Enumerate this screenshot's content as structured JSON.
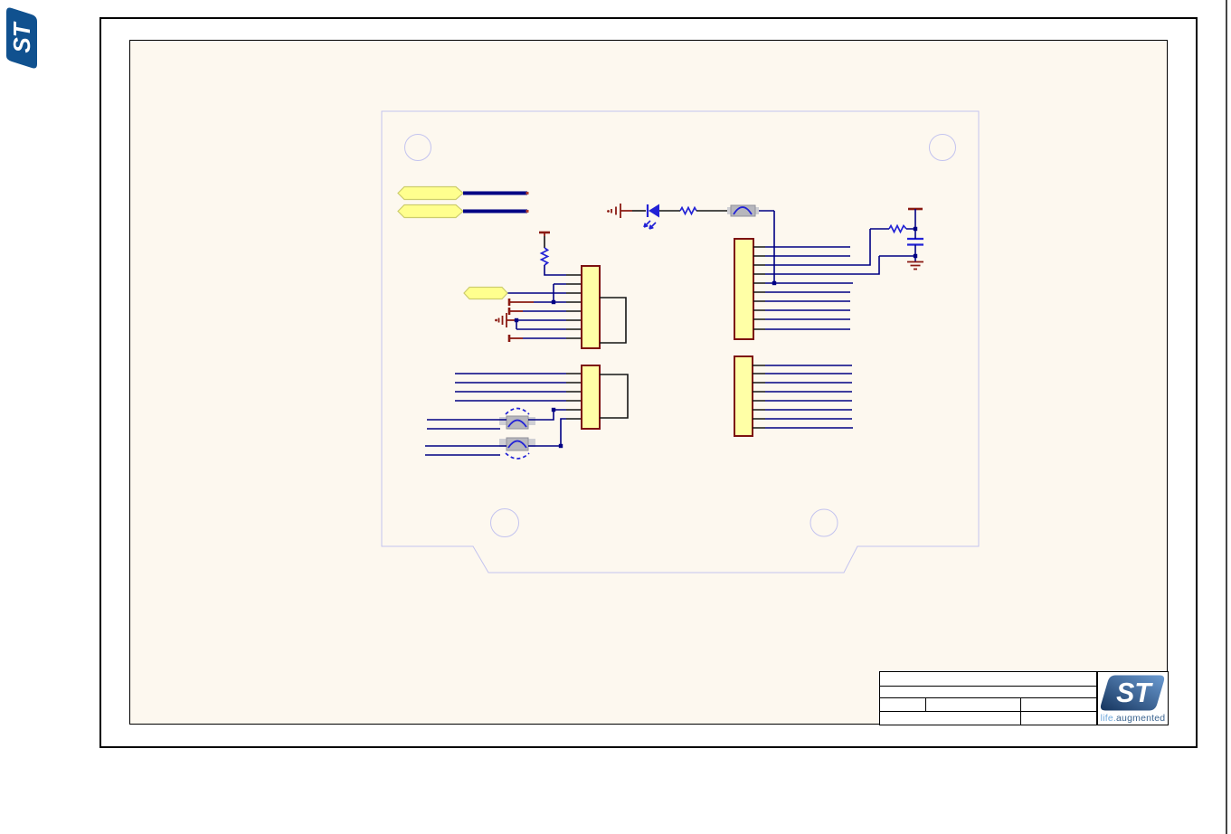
{
  "logos": {
    "st_monogram": "ST",
    "tagline": {
      "prefix": "life.",
      "suffix": "augmented"
    }
  },
  "title_block": {
    "rows": [
      "",
      "",
      "",
      ""
    ],
    "note": ""
  },
  "schematic": {
    "mounting_holes": 4,
    "net_flags": 3,
    "connectors": [
      {
        "id": "upper-left-module",
        "left_pins": 8,
        "right_pins": 2
      },
      {
        "id": "lower-left-module",
        "left_pins": 6,
        "right_pins": 2
      },
      {
        "id": "upper-right-module",
        "right_pins": 10
      },
      {
        "id": "lower-right-module",
        "right_pins": 8
      }
    ],
    "discrete_symbols": [
      "led",
      "series-resistor",
      "ferrite-bead",
      "pull-resistor",
      "filter-resistor",
      "capacitor",
      "solder-bridge",
      "solder-bridge"
    ],
    "ground_symbols": 4,
    "power_bar_symbols": 5
  },
  "colors": {
    "frame": "#000000",
    "sheet_bg": "#fdf8ef",
    "wire": "#000084",
    "pin": "#151515",
    "part_fill": "#ffffa6",
    "part_border": "#7d1111",
    "symbol_blue": "#2222d6",
    "power_red": "#8a1a12",
    "outline": "#c3c3ef",
    "jumper_gray": "#b7b7bd",
    "jumper_pad": "#cfcfd4",
    "flag_fill": "#ffff8e",
    "flag_border": "#cdcd6d",
    "logo_blue": "#10518f",
    "logo_grad_dark": "#16355e",
    "logo_grad_light": "#6b9bd2",
    "tagline_light": "#6fa8dc",
    "tagline_dark": "#3c6590",
    "page_edge": "#444444"
  }
}
